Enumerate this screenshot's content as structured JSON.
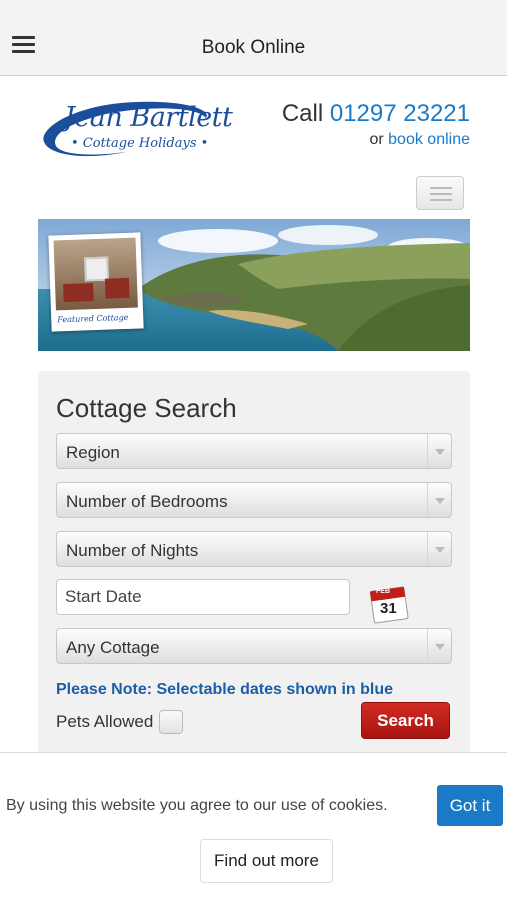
{
  "appbar": {
    "title": "Book Online",
    "menu_icon": "hamburger-menu-icon"
  },
  "logo": {
    "name": "Jean Bartlett",
    "subtitle": "• Cottage Holidays •"
  },
  "contact": {
    "call_prefix": "Call",
    "phone": "01297 23221",
    "online_prefix": "or",
    "online_link": "book online"
  },
  "banner": {
    "featured_label": "Featured Cottage"
  },
  "search": {
    "title": "Cottage Search",
    "region": "Region",
    "bedrooms": "Number of Bedrooms",
    "nights": "Number of Nights",
    "start_date_placeholder": "Start Date",
    "calendar_month": "FEB",
    "calendar_day": "31",
    "cottage": "Any Cottage",
    "note": "Please Note: Selectable dates shown in blue",
    "pets_label": "Pets Allowed",
    "search_button": "Search"
  },
  "cookie": {
    "text": "By using this website you agree to our use of cookies.",
    "accept": "Got it",
    "more": "Find out more"
  },
  "colors": {
    "accent_blue": "#1a7ac8",
    "note_blue": "#1b5ea8",
    "search_red": "#c0201a",
    "logo_blue": "#1b4e9b"
  }
}
